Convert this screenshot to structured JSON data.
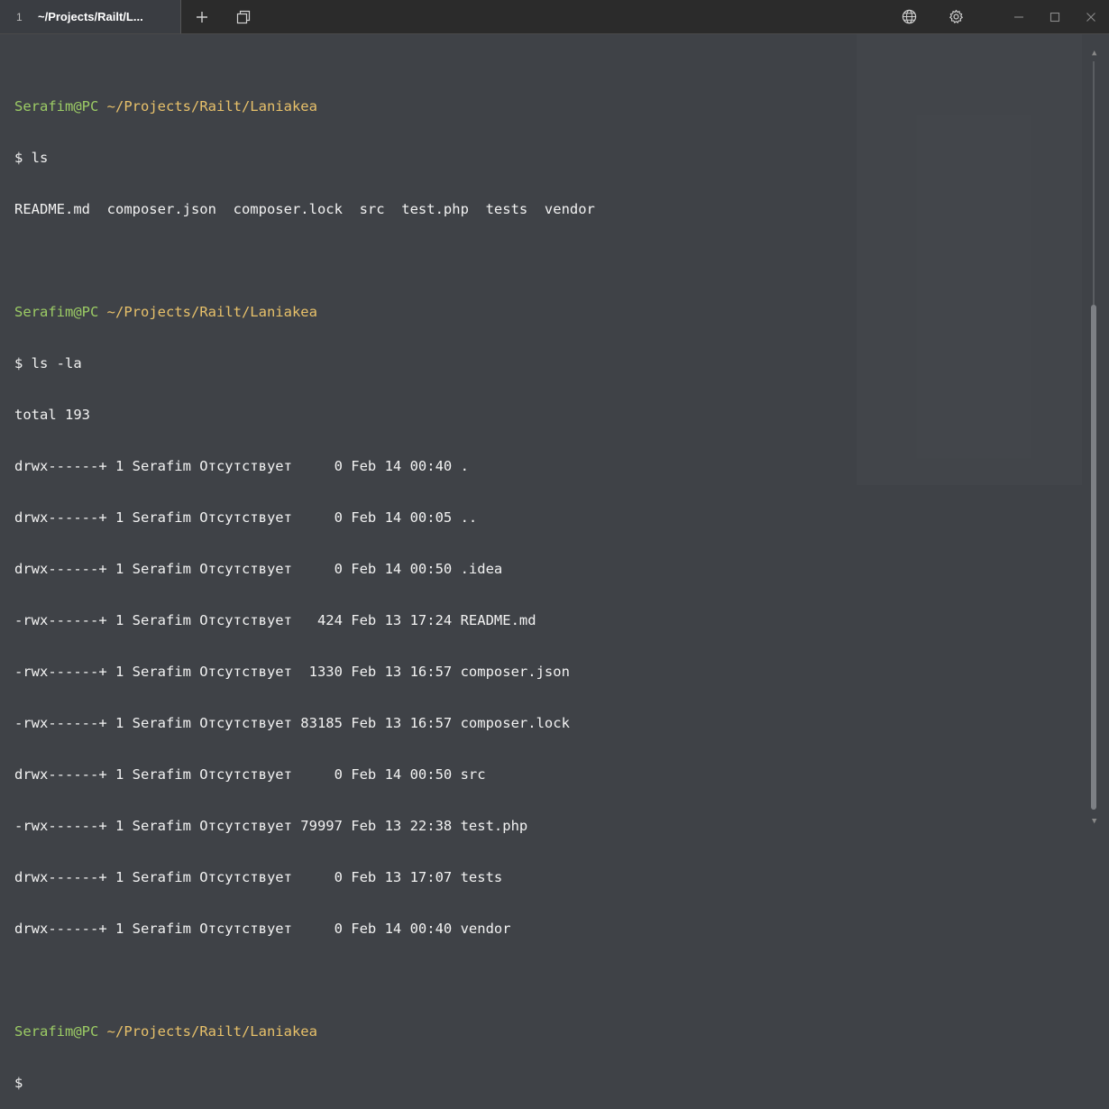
{
  "window": {
    "tab_index": "1",
    "tab_title": "~/Projects/Railt/L...",
    "new_tab_icon": "plus-icon",
    "duplicate_tab_icon": "duplicate-icon",
    "globe_icon": "globe-icon",
    "settings_icon": "gear-icon",
    "minimize_icon": "minimize-icon",
    "maximize_icon": "maximize-icon",
    "close_icon": "close-icon"
  },
  "colors": {
    "background": "#3f4247",
    "prompt_user": "#9ccc65",
    "prompt_path": "#e8c16a",
    "text": "#f2f2f2"
  },
  "terminal": {
    "prompt1": {
      "user": "Serafim@PC",
      "path": "~/Projects/Railt/Laniakea",
      "command": "$ ls"
    },
    "ls_output": "README.md  composer.json  composer.lock  src  test.php  tests  vendor",
    "prompt2": {
      "user": "Serafim@PC",
      "path": "~/Projects/Railt/Laniakea",
      "command": "$ ls -la"
    },
    "total": "total 193",
    "listing": [
      "drwx------+ 1 Serafim Отсутствует     0 Feb 14 00:40 .",
      "drwx------+ 1 Serafim Отсутствует     0 Feb 14 00:05 ..",
      "drwx------+ 1 Serafim Отсутствует     0 Feb 14 00:50 .idea",
      "-rwx------+ 1 Serafim Отсутствует   424 Feb 13 17:24 README.md",
      "-rwx------+ 1 Serafim Отсутствует  1330 Feb 13 16:57 composer.json",
      "-rwx------+ 1 Serafim Отсутствует 83185 Feb 13 16:57 composer.lock",
      "drwx------+ 1 Serafim Отсутствует     0 Feb 14 00:50 src",
      "-rwx------+ 1 Serafim Отсутствует 79997 Feb 13 22:38 test.php",
      "drwx------+ 1 Serafim Отсутствует     0 Feb 13 17:07 tests",
      "drwx------+ 1 Serafim Отсутствует     0 Feb 14 00:40 vendor"
    ],
    "prompt3": {
      "user": "Serafim@PC",
      "path": "~/Projects/Railt/Laniakea",
      "command": "$"
    }
  }
}
